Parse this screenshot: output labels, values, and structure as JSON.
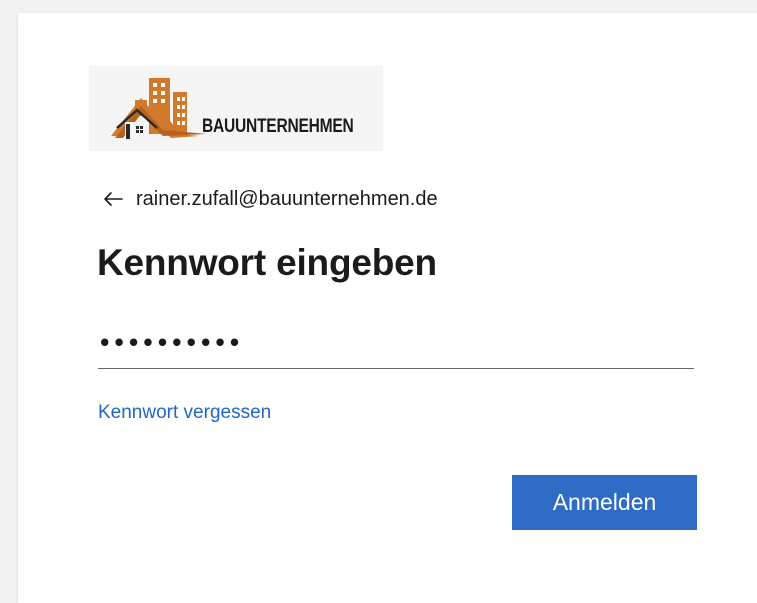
{
  "brand": {
    "name": "BAUUNTERNEHMEN",
    "logo_icon": "building-house-logo",
    "accent_color": "#d17a2c"
  },
  "identity": {
    "back_icon": "arrow-left-icon",
    "email": "rainer.zufall@bauunternehmen.de"
  },
  "page": {
    "title": "Kennwort eingeben"
  },
  "password": {
    "value": "••••••••••",
    "placeholder": "Kennwort"
  },
  "forgot_link": {
    "label": "Kennwort vergessen",
    "color": "#1f67c4"
  },
  "signin_button": {
    "label": "Anmelden",
    "color": "#2d6bc4"
  }
}
